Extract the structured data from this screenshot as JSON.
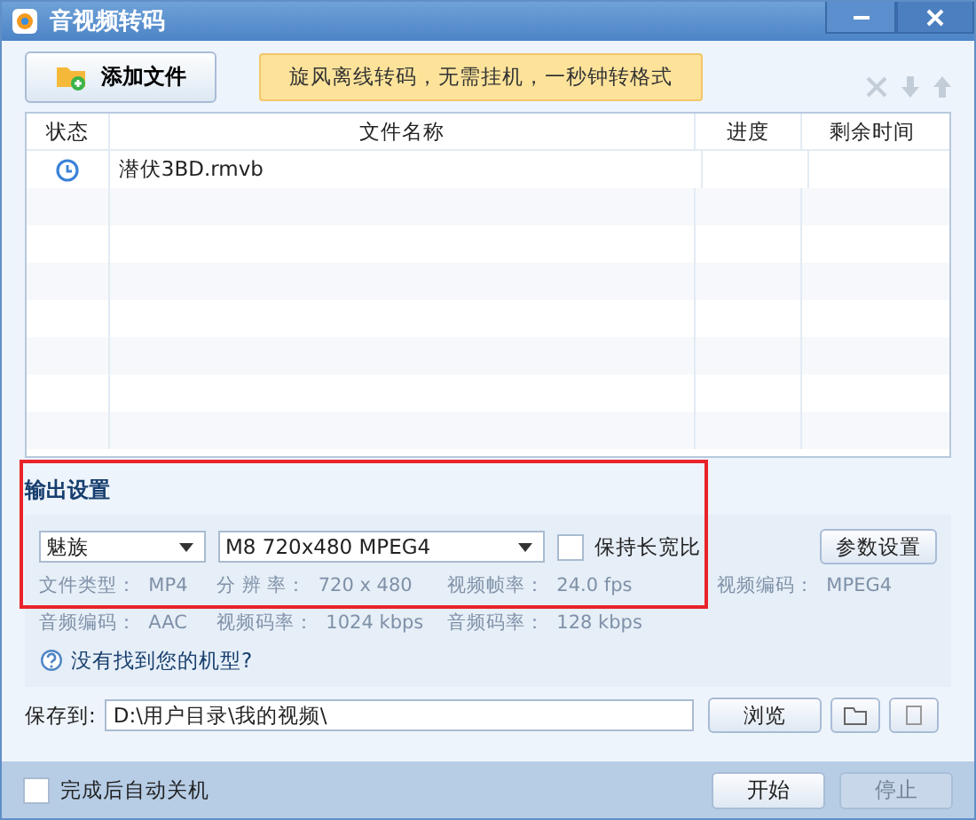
{
  "window": {
    "title": "音视频转码"
  },
  "add_file_button": "添加文件",
  "banner": "旋风离线转码，无需挂机，一秒钟转格式",
  "toolbar": [
    {
      "kind": "delete",
      "disabled": true
    },
    {
      "kind": "down",
      "disabled": true
    },
    {
      "kind": "up",
      "disabled": true
    }
  ],
  "table": {
    "columns": [
      "状态",
      "文件名称",
      "进度",
      "剩余时间"
    ],
    "rows": [
      {
        "kind": "waiting",
        "name": "潜伏3BD.rmvb",
        "progress": "",
        "remaining": ""
      }
    ]
  },
  "output_settings": {
    "title": "输出设置",
    "brand": "魅族",
    "model": "M8 720x480 MPEG4",
    "keep_aspect": {
      "label": "保持长宽比",
      "checked": false
    },
    "params_button": "参数设置",
    "info": [
      [
        {
          "label": "文件类型：",
          "value": "MP4"
        },
        {
          "label": "分 辨 率：",
          "value": "720 x 480"
        },
        {
          "label": "视频帧率：",
          "value": "24.0 fps"
        },
        {
          "label": "视频编码：",
          "value": "MPEG4"
        }
      ],
      [
        {
          "label": "音频编码：",
          "value": "AAC"
        },
        {
          "label": "视频码率：",
          "value": "1024 kbps"
        },
        {
          "label": "音频码率：",
          "value": "128 kbps"
        }
      ]
    ],
    "help_link": "没有找到您的机型?",
    "highlighted": true
  },
  "save": {
    "label": "保存到:",
    "path": "D:\\用户目录\\我的视频\\",
    "browse_button": "浏览"
  },
  "shutdown": {
    "label": "完成后自动关机",
    "checked": false
  },
  "start_button": {
    "label": "开始",
    "disabled": false
  },
  "stop_button": {
    "label": "停止",
    "disabled": true
  }
}
